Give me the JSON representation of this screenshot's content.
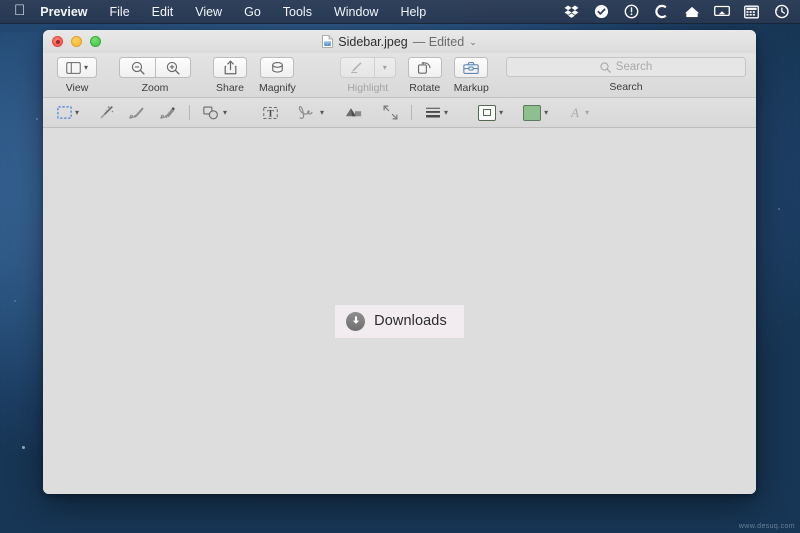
{
  "menubar": {
    "apple_logo": "apple-logo",
    "items": [
      {
        "label": "Preview",
        "bold": true
      },
      {
        "label": "File",
        "bold": false
      },
      {
        "label": "Edit",
        "bold": false
      },
      {
        "label": "View",
        "bold": false
      },
      {
        "label": "Go",
        "bold": false
      },
      {
        "label": "Tools",
        "bold": false
      },
      {
        "label": "Window",
        "bold": false
      },
      {
        "label": "Help",
        "bold": false
      }
    ],
    "status_icons": [
      "dropbox-icon",
      "checkmark-circle-icon",
      "exclamation-circle-icon",
      "c-letter-icon",
      "home-icon",
      "airplay-icon",
      "grid-keypad-icon",
      "clock-history-icon"
    ],
    "background_color": "#2f3f58",
    "text_color": "#ffffff"
  },
  "window": {
    "title": "Sidebar.jpeg",
    "edited_suffix": "— Edited",
    "title_chevron": "⌄",
    "doc_icon": "jpeg-document-icon",
    "traffic_lights": {
      "close": "close-button",
      "minimize": "minimize-button",
      "maximize": "maximize-button",
      "close_color": "#f6534a",
      "minimize_color": "#f7b32c",
      "maximize_color": "#3fc13f"
    }
  },
  "toolbar": {
    "groups": [
      {
        "name": "view",
        "label": "View",
        "icons": [
          "sidebar-icon",
          "chevron-down-icon"
        ],
        "disabled": false
      },
      {
        "name": "zoom",
        "label": "Zoom",
        "icons": [
          "zoom-out-icon",
          "zoom-in-icon"
        ],
        "disabled": false
      },
      {
        "name": "share",
        "label": "Share",
        "icons": [
          "share-icon"
        ],
        "disabled": false
      },
      {
        "name": "magnify",
        "label": "Magnify",
        "icons": [
          "magnify-loupe-icon"
        ],
        "disabled": false
      },
      {
        "name": "highlight",
        "label": "Highlight",
        "icons": [
          "highlight-pen-icon",
          "chevron-down-icon"
        ],
        "disabled": true
      },
      {
        "name": "rotate",
        "label": "Rotate",
        "icons": [
          "rotate-icon"
        ],
        "disabled": false
      },
      {
        "name": "markup",
        "label": "Markup",
        "icons": [
          "markup-toolbox-icon"
        ],
        "disabled": false
      }
    ],
    "search": {
      "label": "Search",
      "placeholder": "Search",
      "value": "",
      "icon": "search-icon"
    }
  },
  "markup_toolbar": {
    "tools": [
      {
        "name": "selection-tool",
        "icon": "dashed-rectangle-icon",
        "has_chevron": true,
        "active": true,
        "disabled": false
      },
      {
        "name": "instant-alpha-tool",
        "icon": "magic-wand-icon",
        "has_chevron": false,
        "active": false,
        "disabled": false
      },
      {
        "name": "sketch-tool",
        "icon": "sketch-pencil-icon",
        "has_chevron": false,
        "active": false,
        "disabled": false
      },
      {
        "name": "draw-tool",
        "icon": "draw-pen-icon",
        "has_chevron": false,
        "active": false,
        "disabled": false
      },
      {
        "name": "shapes-tool",
        "icon": "shapes-icon",
        "has_chevron": true,
        "active": false,
        "disabled": false
      },
      {
        "name": "text-tool",
        "icon": "text-box-icon",
        "has_chevron": false,
        "active": false,
        "disabled": false
      },
      {
        "name": "signature-tool",
        "icon": "signature-icon",
        "has_chevron": true,
        "active": false,
        "disabled": false
      },
      {
        "name": "adjust-color-tool",
        "icon": "prism-adjust-icon",
        "has_chevron": false,
        "active": false,
        "disabled": false
      },
      {
        "name": "adjust-size-tool",
        "icon": "resize-corners-icon",
        "has_chevron": false,
        "active": false,
        "disabled": false
      },
      {
        "name": "shape-style-tool",
        "icon": "line-weight-icon",
        "has_chevron": true,
        "active": false,
        "disabled": false
      },
      {
        "name": "border-color-tool",
        "icon": "border-color-swatch-icon",
        "has_chevron": true,
        "active": false,
        "disabled": false
      },
      {
        "name": "fill-color-tool",
        "icon": "fill-color-swatch-icon",
        "has_chevron": true,
        "active": false,
        "disabled": false
      },
      {
        "name": "text-style-tool",
        "icon": "font-a-icon",
        "has_chevron": true,
        "active": false,
        "disabled": true
      }
    ],
    "border_color": "#4f6b4f",
    "fill_color": "#8fbf8f"
  },
  "canvas": {
    "background_color": "#dddddd",
    "annotation": {
      "label": "Downloads",
      "icon": "downloads-circle-arrow-icon",
      "background_color": "#f2ecf1",
      "text_color": "#2b2b2b"
    }
  },
  "watermark": {
    "text": "www.desuq.com"
  }
}
